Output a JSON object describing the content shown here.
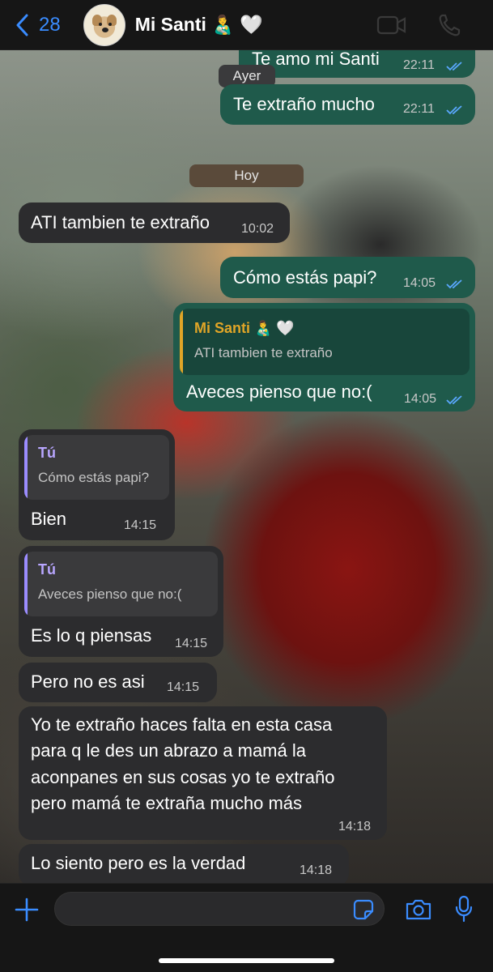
{
  "header": {
    "back_count": "28",
    "contact_name": "Mi Santi 👨‍🍼 🤍"
  },
  "dates": {
    "ayer": "Ayer",
    "hoy": "Hoy"
  },
  "messages": [
    {
      "type": "sent",
      "text": "Te amo mi Santi",
      "time": "22:11"
    },
    {
      "type": "sent",
      "text": "Te extraño mucho",
      "time": "22:11"
    },
    {
      "type": "recv",
      "text": "ATI tambien te extraño",
      "time": "10:02"
    },
    {
      "type": "sent",
      "text": "Cómo estás papi?",
      "time": "14:05"
    },
    {
      "type": "sent",
      "quote_name": "Mi Santi 👨‍🍼 🤍",
      "quote_text": "ATI tambien te extraño",
      "text": "Aveces pienso que no:(",
      "time": "14:05"
    },
    {
      "type": "recv",
      "quote_name": "Tú",
      "quote_text": "Cómo estás papi?",
      "text": "Bien",
      "time": "14:15"
    },
    {
      "type": "recv",
      "quote_name": "Tú",
      "quote_text": "Aveces pienso que no:(",
      "text": "Es lo q piensas",
      "time": "14:15"
    },
    {
      "type": "recv",
      "text": "Pero no es asi",
      "time": "14:15"
    },
    {
      "type": "recv",
      "lines": [
        "Yo te extraño haces falta en esta casa",
        "para q le des un abrazo a mamá la",
        "aconpanes en sus cosas yo te extraño",
        "pero mamá te extraña mucho más"
      ],
      "time": "14:18"
    },
    {
      "type": "recv",
      "text": "Lo siento pero es la verdad",
      "time": "14:18"
    }
  ],
  "input": {
    "placeholder": "",
    "value": ""
  },
  "colors": {
    "accent": "#3a8cff",
    "sent_bubble": "#1f5a4b",
    "recv_bubble": "#2c2c2e",
    "quote_sent_name": "#e0a527",
    "quote_recv_name": "#b8a6ff"
  },
  "icons": [
    "chevron-left-icon",
    "video-camera-icon",
    "phone-icon",
    "plus-icon",
    "sticker-icon",
    "camera-icon",
    "microphone-icon",
    "double-check-icon"
  ]
}
